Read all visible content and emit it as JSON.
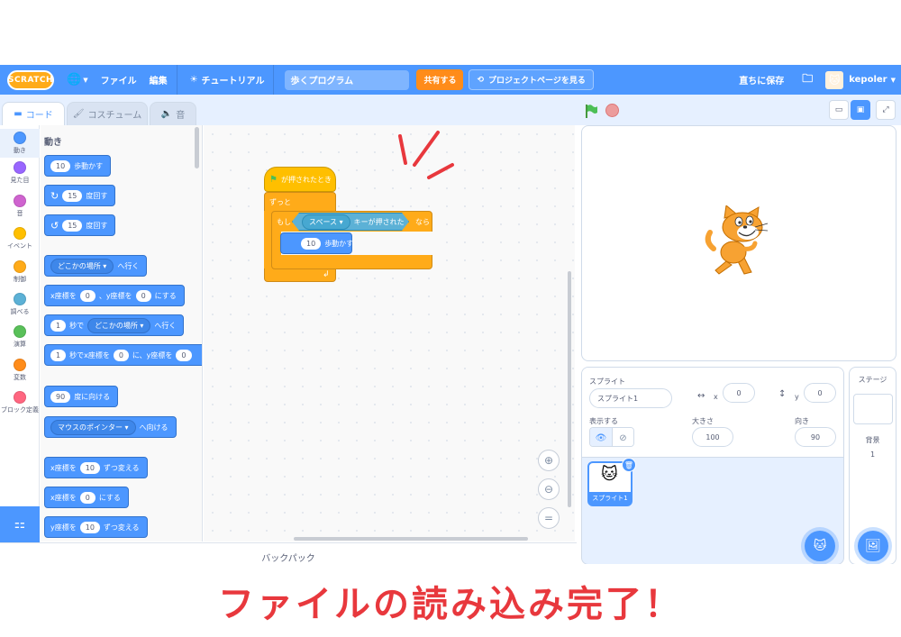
{
  "menubar": {
    "logo": "SCRATCH",
    "language_icon": "globe-icon",
    "file": "ファイル",
    "edit": "編集",
    "tutorials": "チュートリアル",
    "project_title": "歩くプログラム",
    "share": "共有する",
    "project_page": "プロジェクトページを見る",
    "save_now": "直ちに保存",
    "username": "kepoler"
  },
  "tabs": {
    "code": "コード",
    "costumes": "コスチューム",
    "sounds": "音"
  },
  "categories": [
    {
      "label": "動き",
      "color": "#4c97ff"
    },
    {
      "label": "見た目",
      "color": "#9966ff"
    },
    {
      "label": "音",
      "color": "#cf63cf"
    },
    {
      "label": "イベント",
      "color": "#ffbf00"
    },
    {
      "label": "制御",
      "color": "#ffab19"
    },
    {
      "label": "調べる",
      "color": "#5cb1d6"
    },
    {
      "label": "演算",
      "color": "#59c059"
    },
    {
      "label": "変数",
      "color": "#ff8c1a"
    },
    {
      "label": "ブロック定義",
      "color": "#ff6680"
    }
  ],
  "palette": {
    "title": "動き",
    "move_steps": "10",
    "move_label": "歩動かす",
    "turn_right": "15",
    "turn_left": "15",
    "turn_label": "度回す",
    "goto_target": "どこかの場所",
    "goto_label": "へ行く",
    "goto_xy_x_label": "x座標を",
    "goto_xy_x": "0",
    "goto_xy_y_label": "、y座標を",
    "goto_xy_y": "0",
    "goto_xy_end": "にする",
    "glide_secs": "1",
    "glide_label": "秒で",
    "glide_target": "どこかの場所",
    "glide_end": "へ行く",
    "glide_xy_secs": "1",
    "glide_xy_label": "秒でx座標を",
    "glide_xy_x": "0",
    "glide_xy_mid": "に、y座標を",
    "glide_xy_y": "0",
    "point_deg": "90",
    "point_label": "度に向ける",
    "point_towards": "マウスのポインター",
    "point_towards_label": "へ向ける",
    "change_x_label": "x座標を",
    "change_x": "10",
    "change_x_end": "ずつ変える",
    "set_x_label": "x座標を",
    "set_x": "0",
    "set_x_end": "にする",
    "change_y_label": "y座標を",
    "change_y": "10",
    "change_y_end": "ずつ変える"
  },
  "script": {
    "hat": "が押されたとき",
    "forever": "ずっと",
    "if": "もし",
    "key": "スペース",
    "key_pressed": "キーが押された",
    "then": "なら",
    "move_steps": "10",
    "move_label": "歩動かす"
  },
  "backpack": "バックパック",
  "sprite": {
    "section_label": "スプライト",
    "name": "スプライト1",
    "x_label": "x",
    "x": "0",
    "y_label": "y",
    "y": "0",
    "show_label": "表示する",
    "size_label": "大きさ",
    "size": "100",
    "direction_label": "向き",
    "direction": "90",
    "thumb_label": "スプライト1"
  },
  "stage_pane": {
    "title": "ステージ",
    "backdrops_label": "背景",
    "backdrops_count": "1"
  },
  "banner": "ファイルの読み込み完了！",
  "colors": {
    "motion": "#4c97ff",
    "control": "#ffab19",
    "sensing": "#5cb1d6",
    "banner": "#e8383d"
  }
}
